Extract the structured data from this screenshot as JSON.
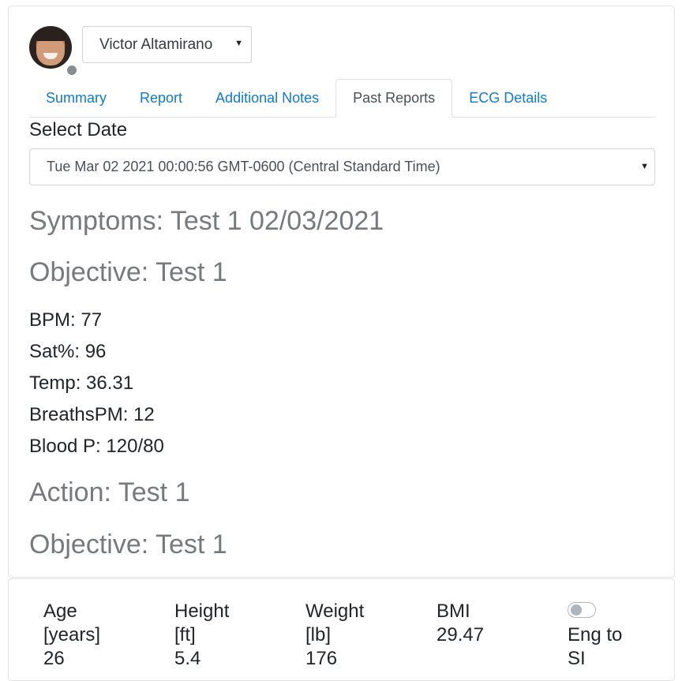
{
  "patient": {
    "name": "Victor Altamirano"
  },
  "tabs": [
    {
      "label": "Summary",
      "active": false
    },
    {
      "label": "Report",
      "active": false
    },
    {
      "label": "Additional Notes",
      "active": false
    },
    {
      "label": "Past Reports",
      "active": true
    },
    {
      "label": "ECG Details",
      "active": false
    }
  ],
  "past_reports": {
    "select_label": "Select Date",
    "selected_date": "Tue Mar 02 2021 00:00:56 GMT-0600 (Central Standard Time)",
    "symptoms": "Symptoms: Test 1 02/03/2021",
    "objective": "Objective: Test 1",
    "vitals": [
      "BPM: 77",
      "Sat%: 96",
      "Temp: 36.31",
      "BreathsPM: 12",
      "Blood P: 120/80"
    ],
    "action": "Action: Test 1",
    "objective_2": "Objective: Test 1"
  },
  "stats": {
    "age": {
      "label": "Age",
      "unit": "[years]",
      "value": "26"
    },
    "height": {
      "label": "Height",
      "unit": "[ft]",
      "value": "5.4"
    },
    "weight": {
      "label": "Weight",
      "unit": "[lb]",
      "value": "176"
    },
    "bmi": {
      "label": "BMI",
      "value": "29.47"
    },
    "unit_toggle": {
      "label_line1": "Eng to",
      "label_line2": "SI",
      "on": false
    }
  },
  "colors": {
    "link": "#0d7bd6",
    "heading_gray": "#777a7d",
    "status_offline": "#8a8d91"
  }
}
